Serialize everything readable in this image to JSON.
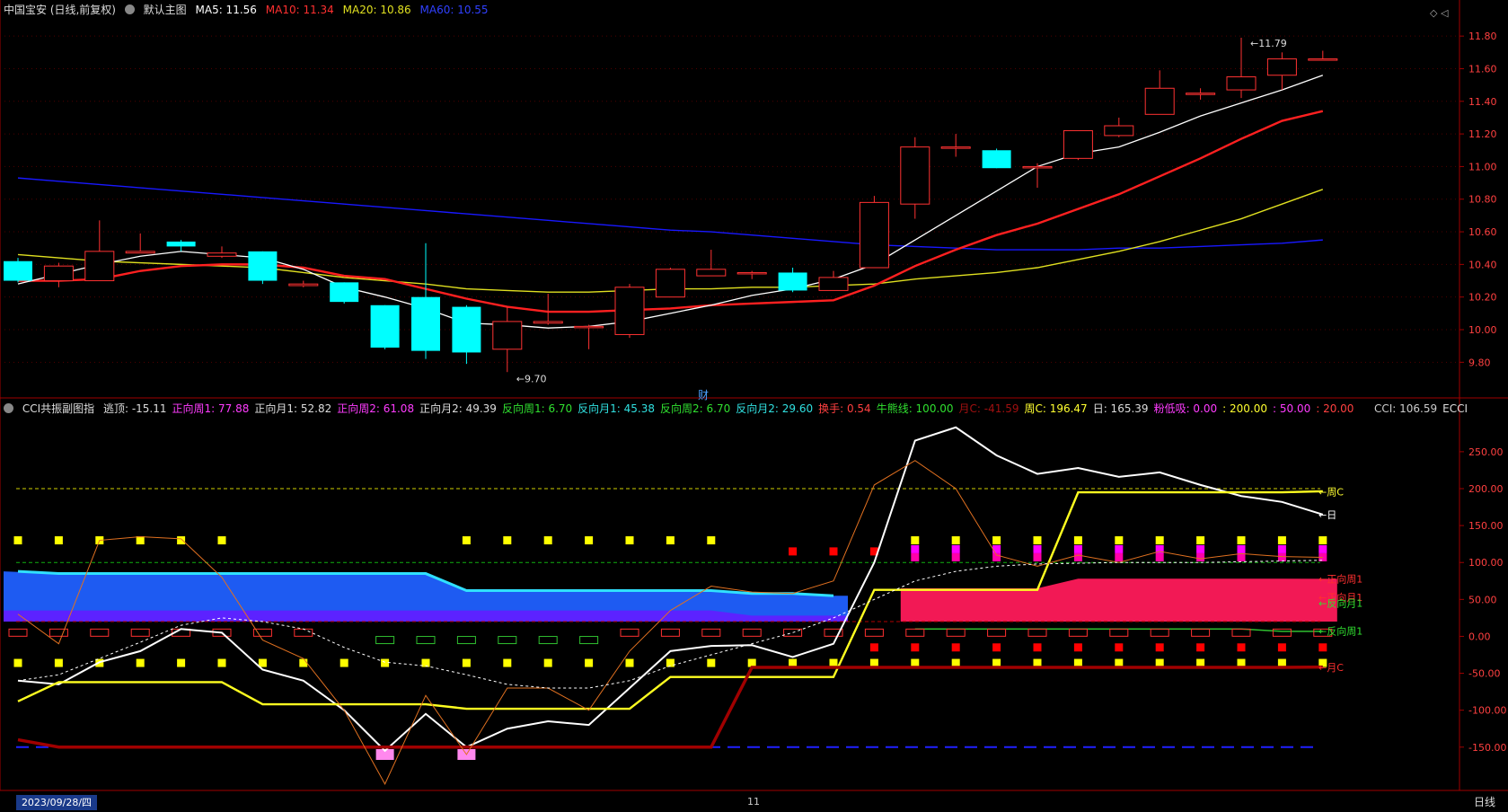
{
  "colors": {
    "bg": "#000000",
    "up": "#ff3232",
    "down": "#00ffff",
    "ma5": "#ffffff",
    "ma10": "#ff2020",
    "ma20": "#e0e020",
    "ma60": "#1818ff",
    "grid": "#500000"
  },
  "main_header": {
    "title": "中国宝安 (日线,前复权)",
    "chart_name": "默认主图",
    "ma5_label": "MA5: 11.56",
    "ma10_label": "MA10: 11.34",
    "ma20_label": "MA20: 10.86",
    "ma60_label": "MA60: 10.55"
  },
  "sub_header": {
    "title": "CCI共振副图指",
    "items": [
      {
        "text": "逃顶: -15.11",
        "color": "#dddddd"
      },
      {
        "text": "正向周1: 77.88",
        "color": "#ff3cff"
      },
      {
        "text": "正向月1: 52.82",
        "color": "#dddddd"
      },
      {
        "text": "正向周2: 61.08",
        "color": "#ff3cff"
      },
      {
        "text": "正向月2: 49.39",
        "color": "#dddddd"
      },
      {
        "text": "反向周1: 6.70",
        "color": "#30e030"
      },
      {
        "text": "反向月1: 45.38",
        "color": "#30e0e0"
      },
      {
        "text": "反向周2: 6.70",
        "color": "#30e030"
      },
      {
        "text": "反向月2: 29.60",
        "color": "#30e0e0"
      },
      {
        "text": "换手: 0.54",
        "color": "#ff4040"
      },
      {
        "text": "牛熊线: 100.00",
        "color": "#30e030"
      },
      {
        "text": "月C: -41.59",
        "color": "#a01010"
      },
      {
        "text": "周C: 196.47",
        "color": "#ffff30"
      },
      {
        "text": "日: 165.39",
        "color": "#dddddd"
      },
      {
        "text": "粉低吸: 0.00",
        "color": "#ff3cff"
      },
      {
        "text": ": 200.00",
        "color": "#ffff30"
      },
      {
        "text": ": 50.00",
        "color": "#ff3cff"
      },
      {
        "text": ": 20.00",
        "color": "#ff4040"
      }
    ],
    "cci_label": "CCI: 106.59",
    "ecci_label": "ECCI"
  },
  "bottom_bar": {
    "date_label": "2023/09/28/四",
    "month_marker": "11",
    "period_button": "日线"
  },
  "finance_marker": "财",
  "chart_data": [
    {
      "type": "candlestick",
      "title": "中国宝安 (日线,前复权)",
      "ylim": [
        9.62,
        11.9
      ],
      "yticks": [
        9.8,
        10.0,
        10.2,
        10.4,
        10.6,
        10.8,
        11.0,
        11.2,
        11.4,
        11.6,
        11.8
      ],
      "candles": [
        [
          10.42,
          10.3,
          10.44,
          10.29
        ],
        [
          10.3,
          10.39,
          10.41,
          10.26
        ],
        [
          10.3,
          10.48,
          10.67,
          10.3
        ],
        [
          10.47,
          10.48,
          10.59,
          10.47
        ],
        [
          10.54,
          10.51,
          10.55,
          10.48
        ],
        [
          10.45,
          10.47,
          10.51,
          10.44
        ],
        [
          10.48,
          10.3,
          10.48,
          10.28
        ],
        [
          10.27,
          10.28,
          10.3,
          10.26
        ],
        [
          10.29,
          10.17,
          10.29,
          10.16
        ],
        [
          10.15,
          9.89,
          10.15,
          9.88
        ],
        [
          10.2,
          9.87,
          10.53,
          9.82
        ],
        [
          10.14,
          9.86,
          10.15,
          9.79
        ],
        [
          9.88,
          10.05,
          10.14,
          9.74
        ],
        [
          10.04,
          10.05,
          10.22,
          10.03
        ],
        [
          10.02,
          10.02,
          10.03,
          9.88
        ],
        [
          9.97,
          10.26,
          10.28,
          9.95
        ],
        [
          10.2,
          10.37,
          10.38,
          10.2
        ],
        [
          10.33,
          10.37,
          10.49,
          10.33
        ],
        [
          10.35,
          10.35,
          10.36,
          10.31
        ],
        [
          10.35,
          10.24,
          10.38,
          10.23
        ],
        [
          10.24,
          10.32,
          10.36,
          10.24
        ],
        [
          10.38,
          10.78,
          10.82,
          10.38
        ],
        [
          10.77,
          11.12,
          11.18,
          10.68
        ],
        [
          11.12,
          11.12,
          11.2,
          11.06
        ],
        [
          11.1,
          10.99,
          11.11,
          10.99
        ],
        [
          11.0,
          11.0,
          11.02,
          10.87
        ],
        [
          11.05,
          11.22,
          11.22,
          11.04
        ],
        [
          11.19,
          11.25,
          11.3,
          11.18
        ],
        [
          11.32,
          11.48,
          11.59,
          11.32
        ],
        [
          11.45,
          11.45,
          11.48,
          11.41
        ],
        [
          11.47,
          11.55,
          11.79,
          11.42
        ],
        [
          11.56,
          11.66,
          11.7,
          11.47
        ],
        [
          11.66,
          11.66,
          11.71,
          11.65
        ]
      ],
      "ma5": [
        10.28,
        10.34,
        10.4,
        10.45,
        10.48,
        10.46,
        10.44,
        10.37,
        10.26,
        10.2,
        10.13,
        10.04,
        10.03,
        10.01,
        10.02,
        10.05,
        10.1,
        10.15,
        10.21,
        10.25,
        10.31,
        10.4,
        10.55,
        10.7,
        10.85,
        11.0,
        11.08,
        11.12,
        11.21,
        11.31,
        11.39,
        11.47,
        11.56
      ],
      "ma10": [
        10.3,
        10.3,
        10.31,
        10.36,
        10.39,
        10.4,
        10.4,
        10.38,
        10.33,
        10.31,
        10.25,
        10.19,
        10.14,
        10.11,
        10.11,
        10.12,
        10.13,
        10.15,
        10.16,
        10.17,
        10.18,
        10.27,
        10.39,
        10.49,
        10.58,
        10.65,
        10.74,
        10.83,
        10.94,
        11.05,
        11.17,
        11.28,
        11.34
      ],
      "ma20": [
        10.46,
        10.44,
        10.42,
        10.41,
        10.4,
        10.39,
        10.38,
        10.35,
        10.32,
        10.3,
        10.28,
        10.25,
        10.24,
        10.23,
        10.23,
        10.24,
        10.25,
        10.25,
        10.26,
        10.26,
        10.27,
        10.28,
        10.31,
        10.33,
        10.35,
        10.38,
        10.43,
        10.48,
        10.54,
        10.61,
        10.68,
        10.77,
        10.86
      ],
      "ma60": [
        10.93,
        10.91,
        10.89,
        10.87,
        10.85,
        10.83,
        10.81,
        10.79,
        10.77,
        10.75,
        10.73,
        10.71,
        10.69,
        10.67,
        10.65,
        10.63,
        10.61,
        10.6,
        10.58,
        10.56,
        10.54,
        10.52,
        10.51,
        10.5,
        10.49,
        10.49,
        10.49,
        10.5,
        10.5,
        10.51,
        10.52,
        10.53,
        10.55
      ],
      "annotations": [
        {
          "text": "11.79",
          "index": 30,
          "value": 11.79
        },
        {
          "text": "9.70",
          "index": 12,
          "value": 9.7
        }
      ]
    },
    {
      "type": "line",
      "title": "CCI共振副图指",
      "ylim": [
        -205,
        290
      ],
      "yticks": [
        -150,
        -100,
        -50,
        0,
        50,
        100,
        150,
        200,
        250
      ],
      "series": [
        {
          "name": "日",
          "color": "#ffffff",
          "values": [
            -60,
            -65,
            -35,
            -20,
            10,
            5,
            -45,
            -60,
            -100,
            -155,
            -105,
            -150,
            -125,
            -115,
            -120,
            -70,
            -20,
            -13,
            -12,
            -28,
            -10,
            100,
            265,
            283,
            245,
            220,
            228,
            216,
            222,
            205,
            190,
            182,
            165
          ]
        },
        {
          "name": "周C",
          "color": "#ffff20",
          "values": [
            -88,
            -62,
            -62,
            -62,
            -62,
            -62,
            -92,
            -92,
            -92,
            -92,
            -92,
            -98,
            -98,
            -98,
            -98,
            -98,
            -55,
            -55,
            -55,
            -55,
            -55,
            63,
            63,
            63,
            63,
            63,
            195,
            195,
            195,
            195,
            195,
            195,
            196.47
          ]
        },
        {
          "name": "月C",
          "color": "#a00000",
          "values": [
            -140,
            -150,
            -150,
            -150,
            -150,
            -150,
            -150,
            -150,
            -150,
            -150,
            -150,
            -150,
            -150,
            -150,
            -150,
            -150,
            -150,
            -150,
            -42,
            -42,
            -42,
            -42,
            -42,
            -42,
            -42,
            -42,
            -42,
            -42,
            -42,
            -42,
            -42,
            -42,
            -41.59
          ]
        },
        {
          "name": "CCI",
          "color": "#e07020",
          "values": [
            30,
            -10,
            130,
            135,
            132,
            80,
            -5,
            -30,
            -100,
            -200,
            -80,
            -160,
            -70,
            -70,
            -100,
            -20,
            35,
            68,
            60,
            58,
            75,
            205,
            238,
            200,
            110,
            95,
            110,
            100,
            115,
            105,
            112,
            108,
            107
          ]
        },
        {
          "name": "ECCI",
          "color": "#ffffff",
          "dashed": true,
          "values": [
            -60,
            -52,
            -30,
            -8,
            15,
            25,
            20,
            10,
            -15,
            -35,
            -40,
            -52,
            -65,
            -70,
            -70,
            -60,
            -40,
            -25,
            -10,
            5,
            25,
            50,
            75,
            88,
            95,
            98,
            99,
            100,
            100,
            100,
            101,
            102,
            103
          ]
        }
      ],
      "bands": [
        {
          "name": "正向周1",
          "color": "#ff1a5a",
          "values": [
            null,
            null,
            null,
            null,
            null,
            null,
            null,
            null,
            null,
            null,
            null,
            null,
            null,
            null,
            null,
            null,
            null,
            null,
            null,
            null,
            null,
            null,
            65,
            65,
            65,
            65,
            78,
            78,
            78,
            78,
            78,
            78,
            77.88
          ]
        },
        {
          "name": "反向周1",
          "color": "#30c030",
          "values": [
            null,
            null,
            null,
            null,
            null,
            null,
            null,
            null,
            null,
            null,
            null,
            null,
            null,
            null,
            null,
            null,
            null,
            null,
            null,
            null,
            null,
            null,
            10,
            10,
            10,
            10,
            10,
            10,
            10,
            10,
            10,
            6.7,
            6.7
          ]
        },
        {
          "name": "正向月1",
          "color": "#2060ff",
          "values": [
            88,
            85,
            85,
            85,
            85,
            85,
            85,
            85,
            85,
            85,
            85,
            62,
            62,
            62,
            62,
            62,
            62,
            62,
            58,
            58,
            55,
            null,
            null,
            null,
            null,
            null,
            null,
            null,
            null,
            null,
            null,
            null,
            null
          ]
        },
        {
          "name": "反向月1",
          "color": "#6020ff",
          "values": [
            35,
            35,
            35,
            35,
            35,
            35,
            35,
            35,
            35,
            35,
            35,
            35,
            35,
            35,
            35,
            35,
            35,
            35,
            28,
            28,
            28,
            null,
            null,
            null,
            null,
            null,
            null,
            null,
            null,
            null,
            null,
            null,
            null
          ]
        }
      ],
      "reference_lines": [
        {
          "value": 200,
          "color": "#d0d000",
          "style": "dashed"
        },
        {
          "value": 100,
          "color": "#10b010",
          "style": "dashed"
        },
        {
          "value": 20,
          "color": "#b00000",
          "style": "dashed"
        },
        {
          "value": -150,
          "color": "#2020ff",
          "style": "dashed"
        }
      ],
      "markers": {
        "row130": [
          "Y",
          "Y",
          "Y",
          "Y",
          "Y",
          "Y",
          null,
          null,
          null,
          null,
          null,
          "Y",
          "Y",
          "Y",
          "Y",
          "Y",
          "Y",
          "Y",
          null,
          "R",
          "R",
          "R",
          "YM",
          "YM",
          "YM",
          "YM",
          "YM",
          "YM",
          "YM",
          "YM",
          "YM",
          "YM",
          "YM"
        ],
        "row0": [
          "RB",
          "RB",
          "RB",
          "RB",
          "RB",
          "RB",
          "RB",
          "RB",
          null,
          "GB",
          "GB",
          "GB",
          "GB",
          "GB",
          "GB",
          "RB",
          "RB",
          "RB",
          "RB",
          "RB",
          "RB",
          "RB",
          "RB",
          "RB",
          "RB",
          "RB",
          "RB",
          "RB",
          "RB",
          "RB",
          "RB",
          "RB",
          "RB"
        ],
        "row15": [
          null,
          null,
          null,
          null,
          null,
          null,
          null,
          null,
          null,
          null,
          null,
          null,
          null,
          null,
          null,
          null,
          null,
          null,
          null,
          null,
          null,
          "R",
          "R",
          "R",
          "R",
          "R",
          "R",
          "R",
          "R",
          "R",
          "R",
          "R",
          "R"
        ],
        "row_m36": [
          "Y",
          "Y",
          "Y",
          "Y",
          "Y",
          "Y",
          "Y",
          "Y",
          "Y",
          "Y",
          "Y",
          "Y",
          "Y",
          "Y",
          "Y",
          "Y",
          "Y",
          "Y",
          "Y",
          "Y",
          "Y",
          "Y",
          "Y",
          "Y",
          "Y",
          "Y",
          "Y",
          "Y",
          "Y",
          "Y",
          "Y",
          "Y",
          "Y"
        ],
        "pink": [
          9,
          11
        ]
      },
      "right_labels": [
        {
          "text": "←周C",
          "value": 196,
          "color": "#ffff30"
        },
        {
          "text": "←日",
          "value": 165,
          "color": "#ffffff"
        },
        {
          "text": "←正向周1",
          "value": 78,
          "color": "#ff3030"
        },
        {
          "text": "←正向月1",
          "value": 53,
          "color": "#ff3030"
        },
        {
          "text": "←反向月1",
          "value": 45,
          "color": "#30e030"
        },
        {
          "text": "←反向周1",
          "value": 7,
          "color": "#30e030"
        },
        {
          "text": "←月C",
          "value": -42,
          "color": "#ff3030"
        }
      ]
    }
  ]
}
